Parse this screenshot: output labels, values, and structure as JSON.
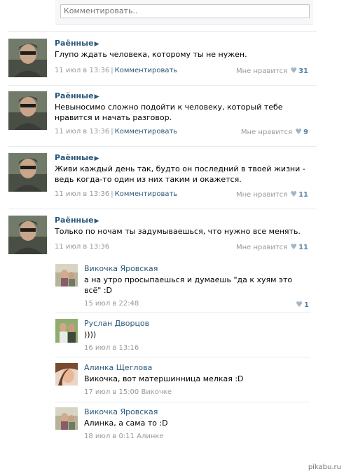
{
  "comment_box": {
    "placeholder": "Комментировать.."
  },
  "posts": [
    {
      "author": "Раённые",
      "text": "Глупо ждать человека, которому ты не нужен.",
      "date": "11 июл в 13:36",
      "comment_label": "Комментировать",
      "like_label": "Мне нравится",
      "like_count": "31"
    },
    {
      "author": "Раённые",
      "text": "Невыносимо сложно подойти к человеку, который тебе нравится и начать разговор.",
      "date": "11 июл в 13:36",
      "comment_label": "Комментировать",
      "like_label": "Мне нравится",
      "like_count": "9"
    },
    {
      "author": "Раённые",
      "text": "Живи каждый день так, будто он последний в твоей жизни - ведь когда-то один из них таким и окажется.",
      "date": "11 июл в 13:36",
      "comment_label": "Комментировать",
      "like_label": "Мне нравится",
      "like_count": "11"
    },
    {
      "author": "Раённые",
      "text": "Только по ночам ты задумываешься, что нужно все менять.",
      "date": "11 июл в 13:36",
      "like_label": "Мне нравится",
      "like_count": "11"
    }
  ],
  "replies": [
    {
      "author": "Викочка Яровская",
      "text": "а на утро просыпаешься и думаешь \"да к хуям это всё\" :D",
      "date": "15 июл в 22:48",
      "like_count": "1"
    },
    {
      "author": "Руслан Дворцов",
      "text": "))))",
      "date": "16 июл в 13:16"
    },
    {
      "author": "Алинка Щеглова",
      "text": "Викочка, вот матершинница мелкая :D",
      "date": "17 июл в 15:00 Викочке"
    },
    {
      "author": "Викочка Яровская",
      "text": "Алинка, а сама то :D",
      "date": "18 июл в 0:11 Алинке"
    }
  ],
  "watermark": "pikabu.ru",
  "icons": {
    "play": "play-icon",
    "heart": "heart-icon"
  },
  "colors": {
    "link": "#2b587a",
    "meta": "#999999",
    "like_count": "#5e82a8"
  }
}
